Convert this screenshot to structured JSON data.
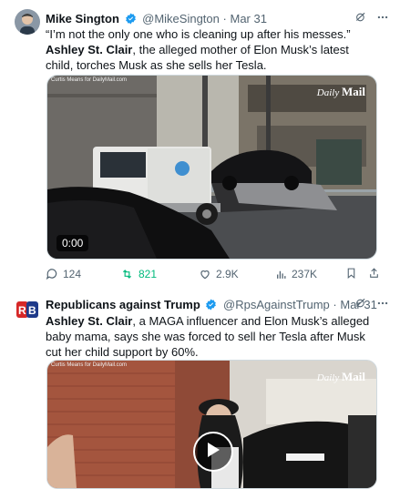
{
  "tweets": [
    {
      "name": "Mike Sington",
      "handle": "@MikeSington",
      "sep": "·",
      "date": "Mar 31",
      "text_plain1": "“I’m not the only one who is cleaning up after his messes.”",
      "text_bold": "Ashley St. Clair",
      "text_plain2": ", the alleged mother of Elon Musk’s latest child, torches Musk as she sells her Tesla.",
      "media": {
        "duration": "0:00",
        "credit": "Curtis Means for DailyMail.com",
        "watermark_a": "Daily",
        "watermark_b": "Mail"
      },
      "actions": {
        "replies": "124",
        "reposts": "821",
        "likes": "2.9K",
        "views": "237K"
      }
    },
    {
      "name": "Republicans against Trump",
      "handle": "@RpsAgainstTrump",
      "sep": "·",
      "date": "Mar 31",
      "text_bold": "Ashley St. Clair",
      "text_plain2": ", a MAGA influencer and Elon Musk’s alleged baby mama, says she was forced to sell her Tesla after Musk cut her child support by 60%.",
      "media": {
        "credit": "Curtis Means for DailyMail.com",
        "watermark_a": "Daily",
        "watermark_b": "Mail"
      }
    }
  ],
  "colors": {
    "verified": "#1d9bf0",
    "repost_active": "#00ba7c",
    "secondary_text": "#536471"
  }
}
